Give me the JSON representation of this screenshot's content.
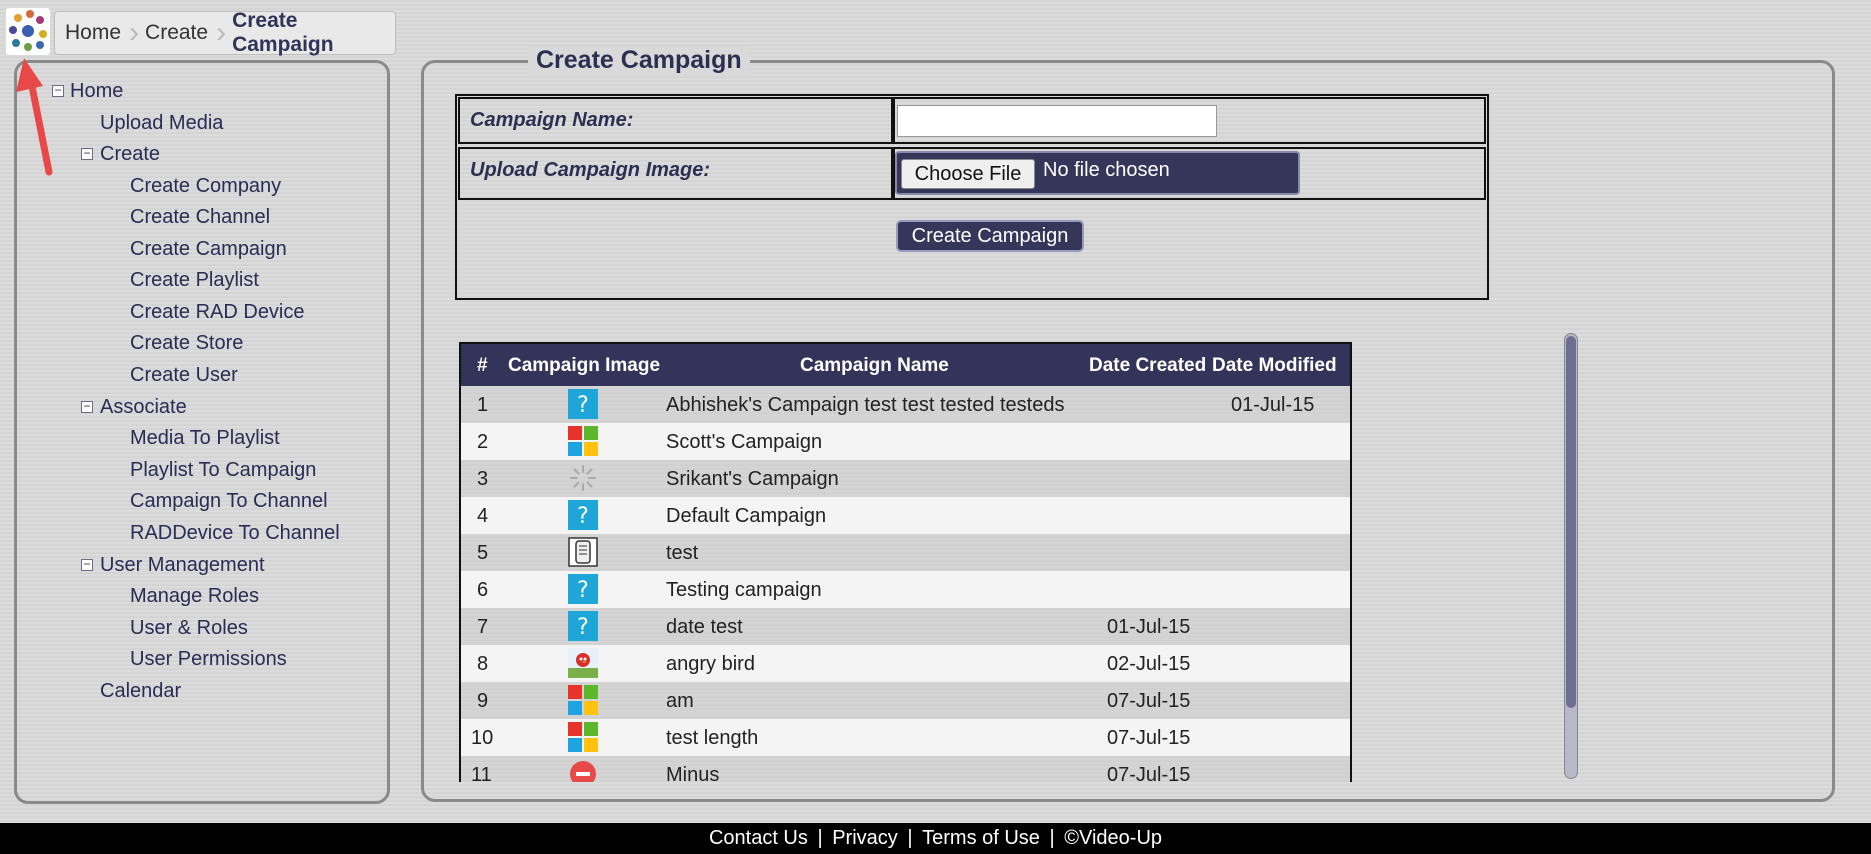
{
  "breadcrumb": {
    "items": [
      "Home",
      "Create"
    ],
    "current": "Create Campaign"
  },
  "sidebar": {
    "home": "Home",
    "upload_media": "Upload Media",
    "create": "Create",
    "create_company": "Create Company",
    "create_channel": "Create Channel",
    "create_campaign": "Create Campaign",
    "create_playlist": "Create Playlist",
    "create_rad_device": "Create RAD Device",
    "create_store": "Create Store",
    "create_user": "Create User",
    "associate": "Associate",
    "media_to_playlist": "Media To Playlist",
    "playlist_to_campaign": "Playlist To Campaign",
    "campaign_to_channel": "Campaign To Channel",
    "raddevice_to_channel": "RADDevice To Channel",
    "user_management": "User Management",
    "manage_roles": "Manage Roles",
    "user_roles": "User & Roles",
    "user_permissions": "User Permissions",
    "calendar": "Calendar"
  },
  "panel": {
    "title": "Create Campaign",
    "campaign_name_label": "Campaign Name:",
    "campaign_name_value": "",
    "upload_image_label": "Upload Campaign Image:",
    "choose_file_label": "Choose File",
    "file_status": "No file chosen",
    "create_button": "Create Campaign"
  },
  "table": {
    "headers": [
      "#",
      "Campaign Image",
      "Campaign Name",
      "Date Created",
      "Date Modified"
    ],
    "rows": [
      {
        "num": "1",
        "image": "question-icon",
        "name": "Abhishek's Campaign test test tested testeds",
        "created": "",
        "modified": "01-Jul-15"
      },
      {
        "num": "2",
        "image": "windows-tiles-icon",
        "name": "Scott's Campaign",
        "created": "",
        "modified": ""
      },
      {
        "num": "3",
        "image": "loading-spinner-icon",
        "name": "Srikant's Campaign",
        "created": "",
        "modified": ""
      },
      {
        "num": "4",
        "image": "question-icon",
        "name": "Default Campaign",
        "created": "",
        "modified": ""
      },
      {
        "num": "5",
        "image": "document-icon",
        "name": "test",
        "created": "",
        "modified": ""
      },
      {
        "num": "6",
        "image": "question-icon",
        "name": "Testing campaign",
        "created": "",
        "modified": ""
      },
      {
        "num": "7",
        "image": "question-icon",
        "name": "date test",
        "created": "01-Jul-15",
        "modified": ""
      },
      {
        "num": "8",
        "image": "angry-bird-icon",
        "name": "angry bird",
        "created": "02-Jul-15",
        "modified": ""
      },
      {
        "num": "9",
        "image": "windows-tiles-icon",
        "name": "am",
        "created": "07-Jul-15",
        "modified": ""
      },
      {
        "num": "10",
        "image": "windows-tiles-icon",
        "name": "test length",
        "created": "07-Jul-15",
        "modified": ""
      },
      {
        "num": "11",
        "image": "minus-icon",
        "name": "Minus",
        "created": "07-Jul-15",
        "modified": ""
      }
    ]
  },
  "footer": {
    "contact": "Contact Us",
    "privacy": "Privacy",
    "terms": "Terms of Use",
    "copyright": "©Video-Up",
    "separator": "|"
  },
  "colors": {
    "accent": "#34345a",
    "annotation_arrow": "#e84848"
  }
}
